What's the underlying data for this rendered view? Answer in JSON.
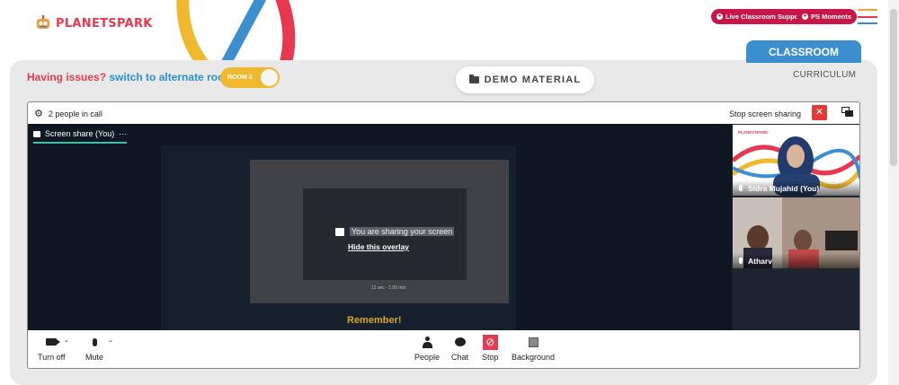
{
  "header": {
    "brand": "PLANETSPARK",
    "support_label": "Live Classroom Support",
    "moments_label": "PS Moments",
    "colors": {
      "brand_red": "#c6164a",
      "accent_blue": "#3c8fcf",
      "toggle_yellow": "#f0b82d"
    }
  },
  "room": {
    "issues_text": "Having issues?",
    "switch_text": "switch to alternate room",
    "toggle_label": "ROOM 2",
    "demo_label": "DEMO MATERIAL"
  },
  "tabs": {
    "classroom": "CLASSROOM",
    "curriculum": "CURRICULUM"
  },
  "call": {
    "people_count": "2 people in call",
    "stop_sharing": "Stop screen sharing",
    "screen_tab": "Screen share (You)",
    "more": "···",
    "overlay_text": "You are sharing your screen",
    "hide_overlay": "Hide this overlay",
    "shot_caption": "12 sec - 1:00 min",
    "remember": "Remember!"
  },
  "participants": [
    {
      "name": "Sidra Mujahid (You)",
      "logo": "PLANETSPARK"
    },
    {
      "name": "Atharv"
    }
  ],
  "controls": {
    "camera": "Turn off",
    "mute": "Mute",
    "people": "People",
    "chat": "Chat",
    "stop": "Stop",
    "background": "Background"
  }
}
